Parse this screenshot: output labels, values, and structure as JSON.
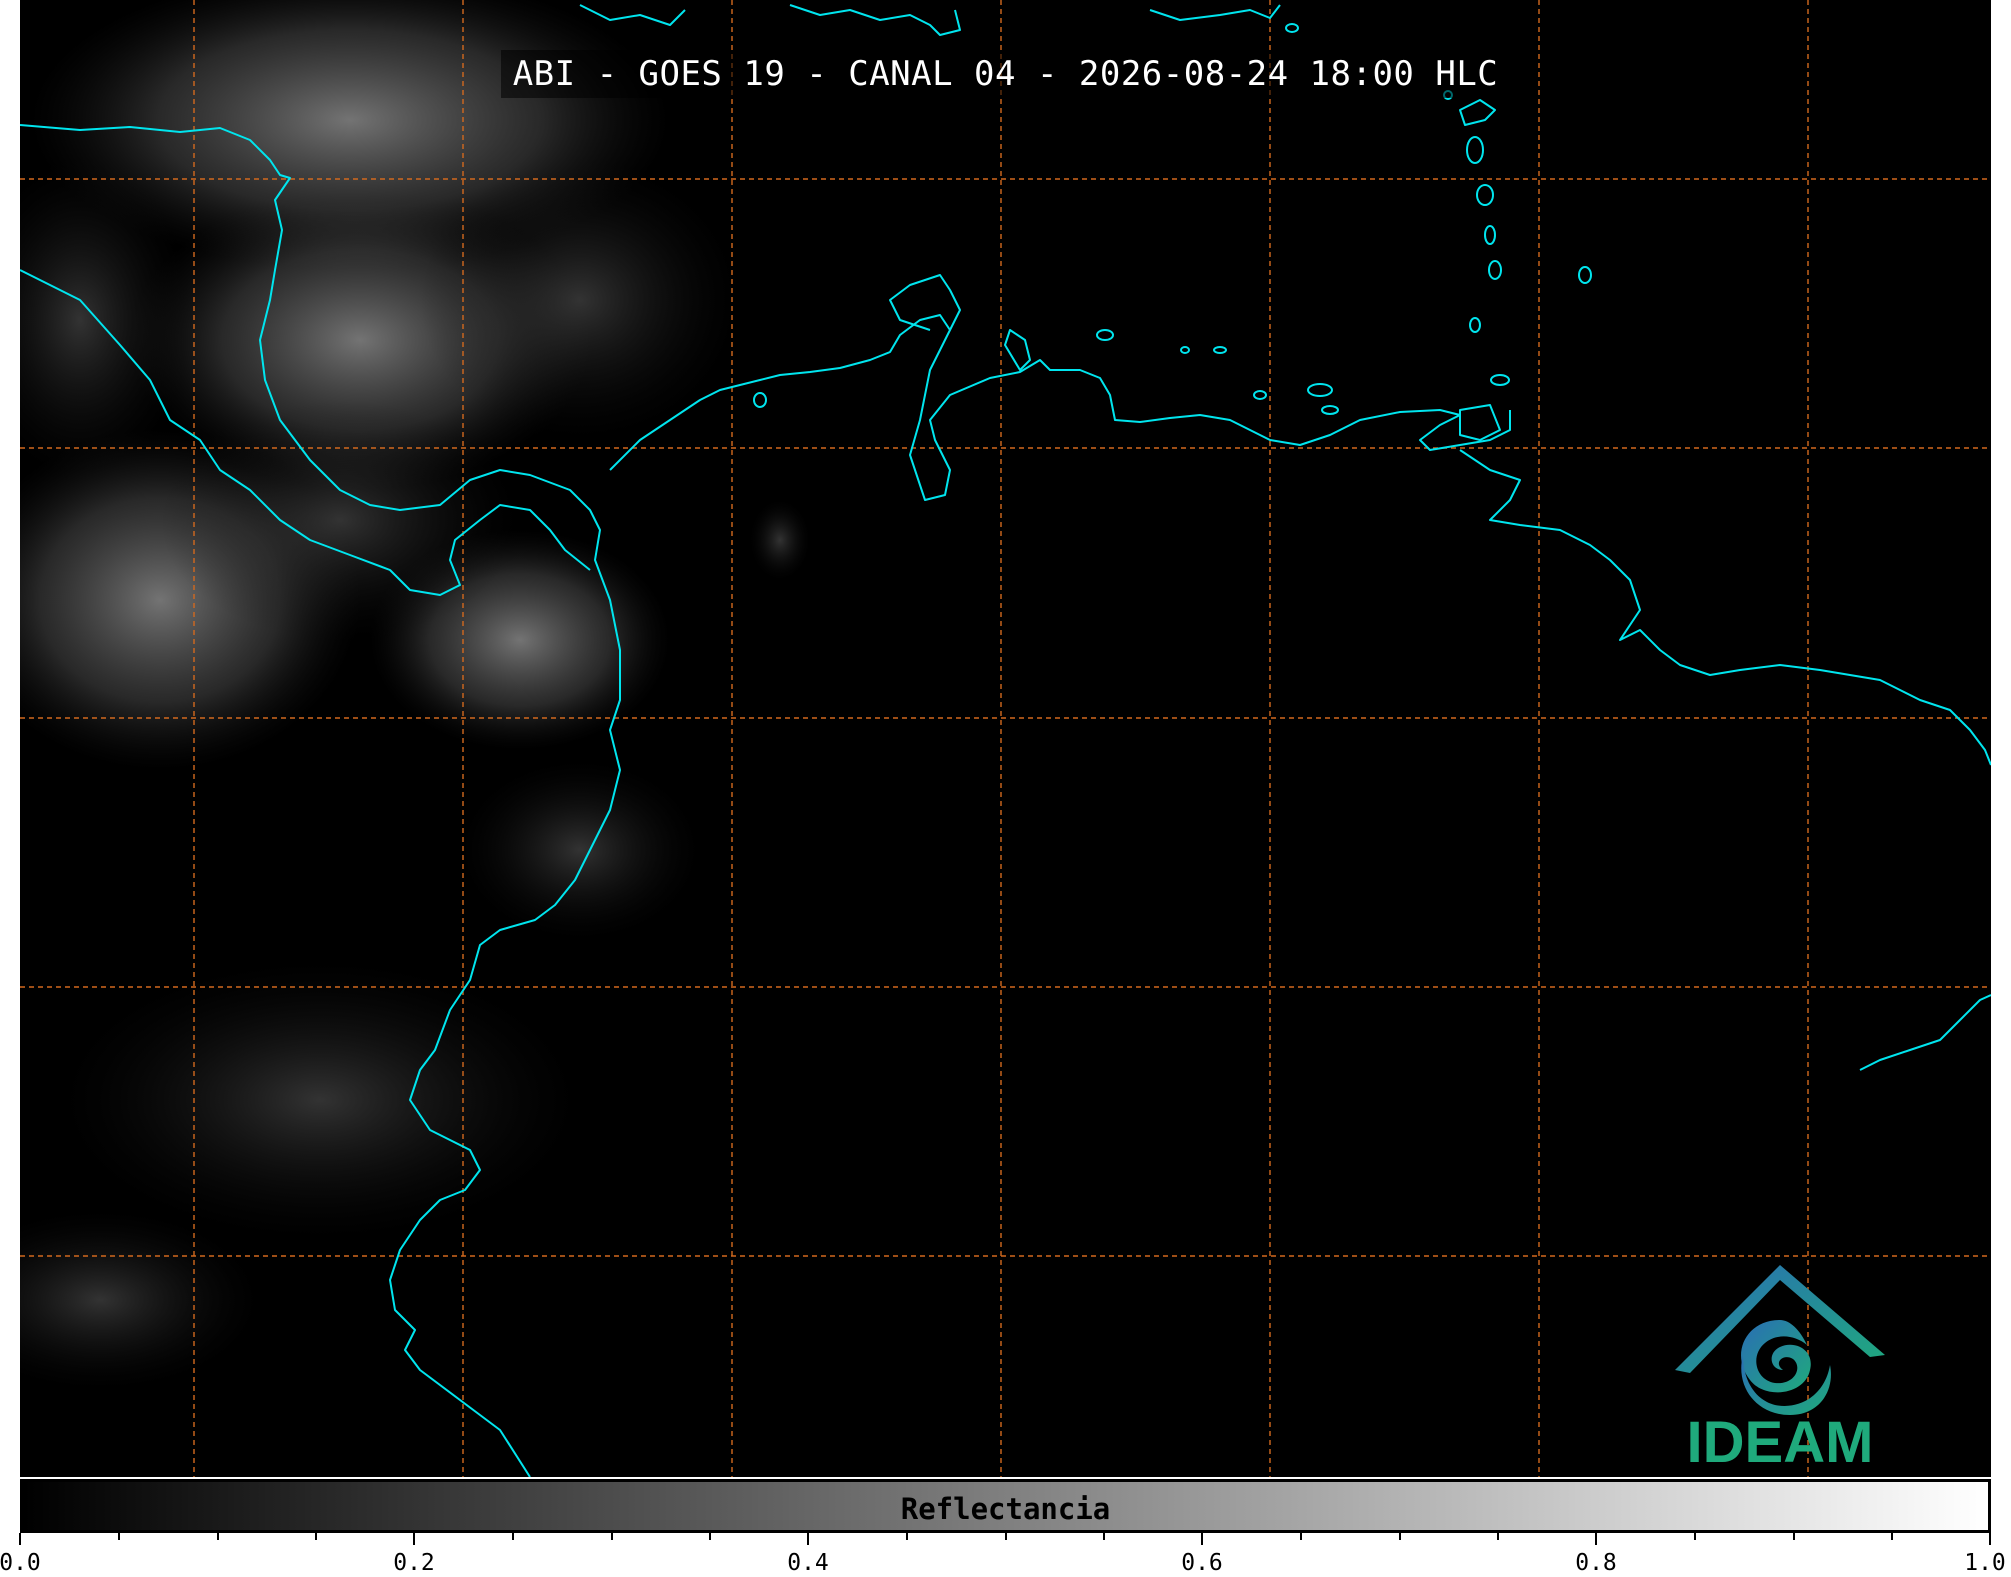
{
  "title": "ABI - GOES 19 - CANAL 04 - 2026-08-24 18:00 HLC",
  "colorbar": {
    "label": "Reflectancia",
    "ticks": [
      "0.0",
      "0.2",
      "0.4",
      "0.6",
      "0.8",
      "1.0"
    ],
    "range": [
      0.0,
      1.0
    ],
    "colormap": "gray"
  },
  "logo": {
    "text": "IDEAM"
  },
  "colors": {
    "coastline": "#00e5ee",
    "grid": "#d2691e",
    "logo_teal": "#1faa7c",
    "logo_blue": "#2a6db5"
  }
}
